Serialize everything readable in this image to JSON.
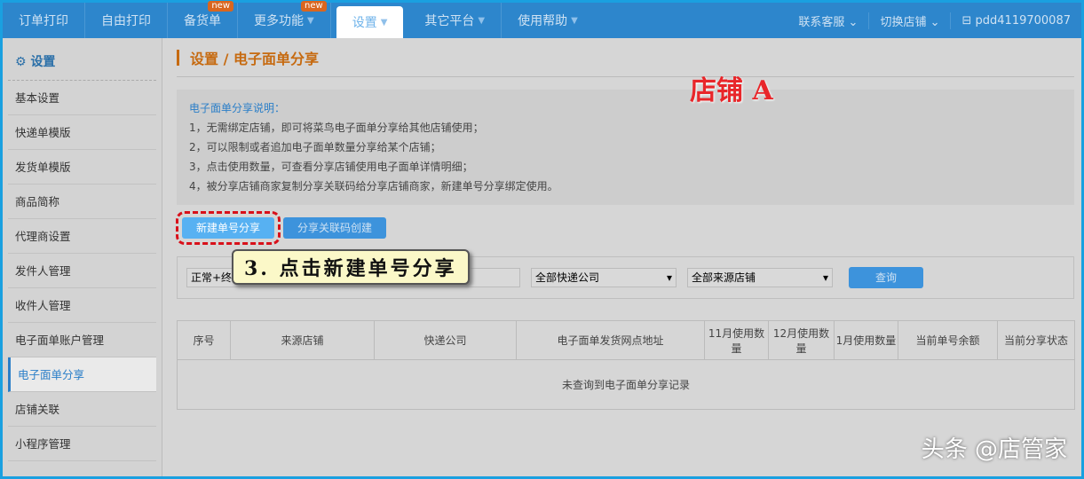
{
  "nav": {
    "items": [
      {
        "label": "订单打印"
      },
      {
        "label": "自由打印"
      },
      {
        "label": "备货单",
        "badge": "new"
      },
      {
        "label": "更多功能",
        "badge": "new"
      },
      {
        "label": "设置"
      },
      {
        "label": "其它平台"
      },
      {
        "label": "使用帮助"
      }
    ],
    "contact": "联系客服",
    "switch_shop": "切换店铺",
    "account": "pdd4119700087"
  },
  "sidebar": {
    "title": "设置",
    "items": [
      "基本设置",
      "快递单模版",
      "发货单模版",
      "商品简称",
      "代理商设置",
      "发件人管理",
      "收件人管理",
      "电子面单账户管理",
      "电子面单分享",
      "店铺关联",
      "小程序管理"
    ]
  },
  "breadcrumb": "设置 / 电子面单分享",
  "annotation": "店铺 A",
  "info": {
    "title": "电子面单分享说明：",
    "lines": [
      "1，无需绑定店铺，即可将菜鸟电子面单分享给其他店铺使用；",
      "2，可以限制或者追加电子面单数量分享给某个店铺；",
      "3，点击使用数量，可查看分享店铺使用电子面单详情明细；",
      "4，被分享店铺商家复制分享关联码给分享店铺商家，新建单号分享绑定使用。"
    ]
  },
  "buttons": {
    "new_share": "新建单号分享",
    "code_create": "分享关联码创建"
  },
  "tooltip": "3. 点击新建单号分享",
  "filter": {
    "status": "正常+终",
    "express": "全部快递公司",
    "source": "全部来源店铺",
    "query": "查询"
  },
  "table": {
    "headers": [
      "序号",
      "来源店铺",
      "快递公司",
      "电子面单发货网点地址",
      "11月使用数量",
      "12月使用数量",
      "1月使用数量",
      "当前单号余额",
      "当前分享状态"
    ],
    "empty": "未查询到电子面单分享记录"
  },
  "watermark": "头条 @店管家"
}
